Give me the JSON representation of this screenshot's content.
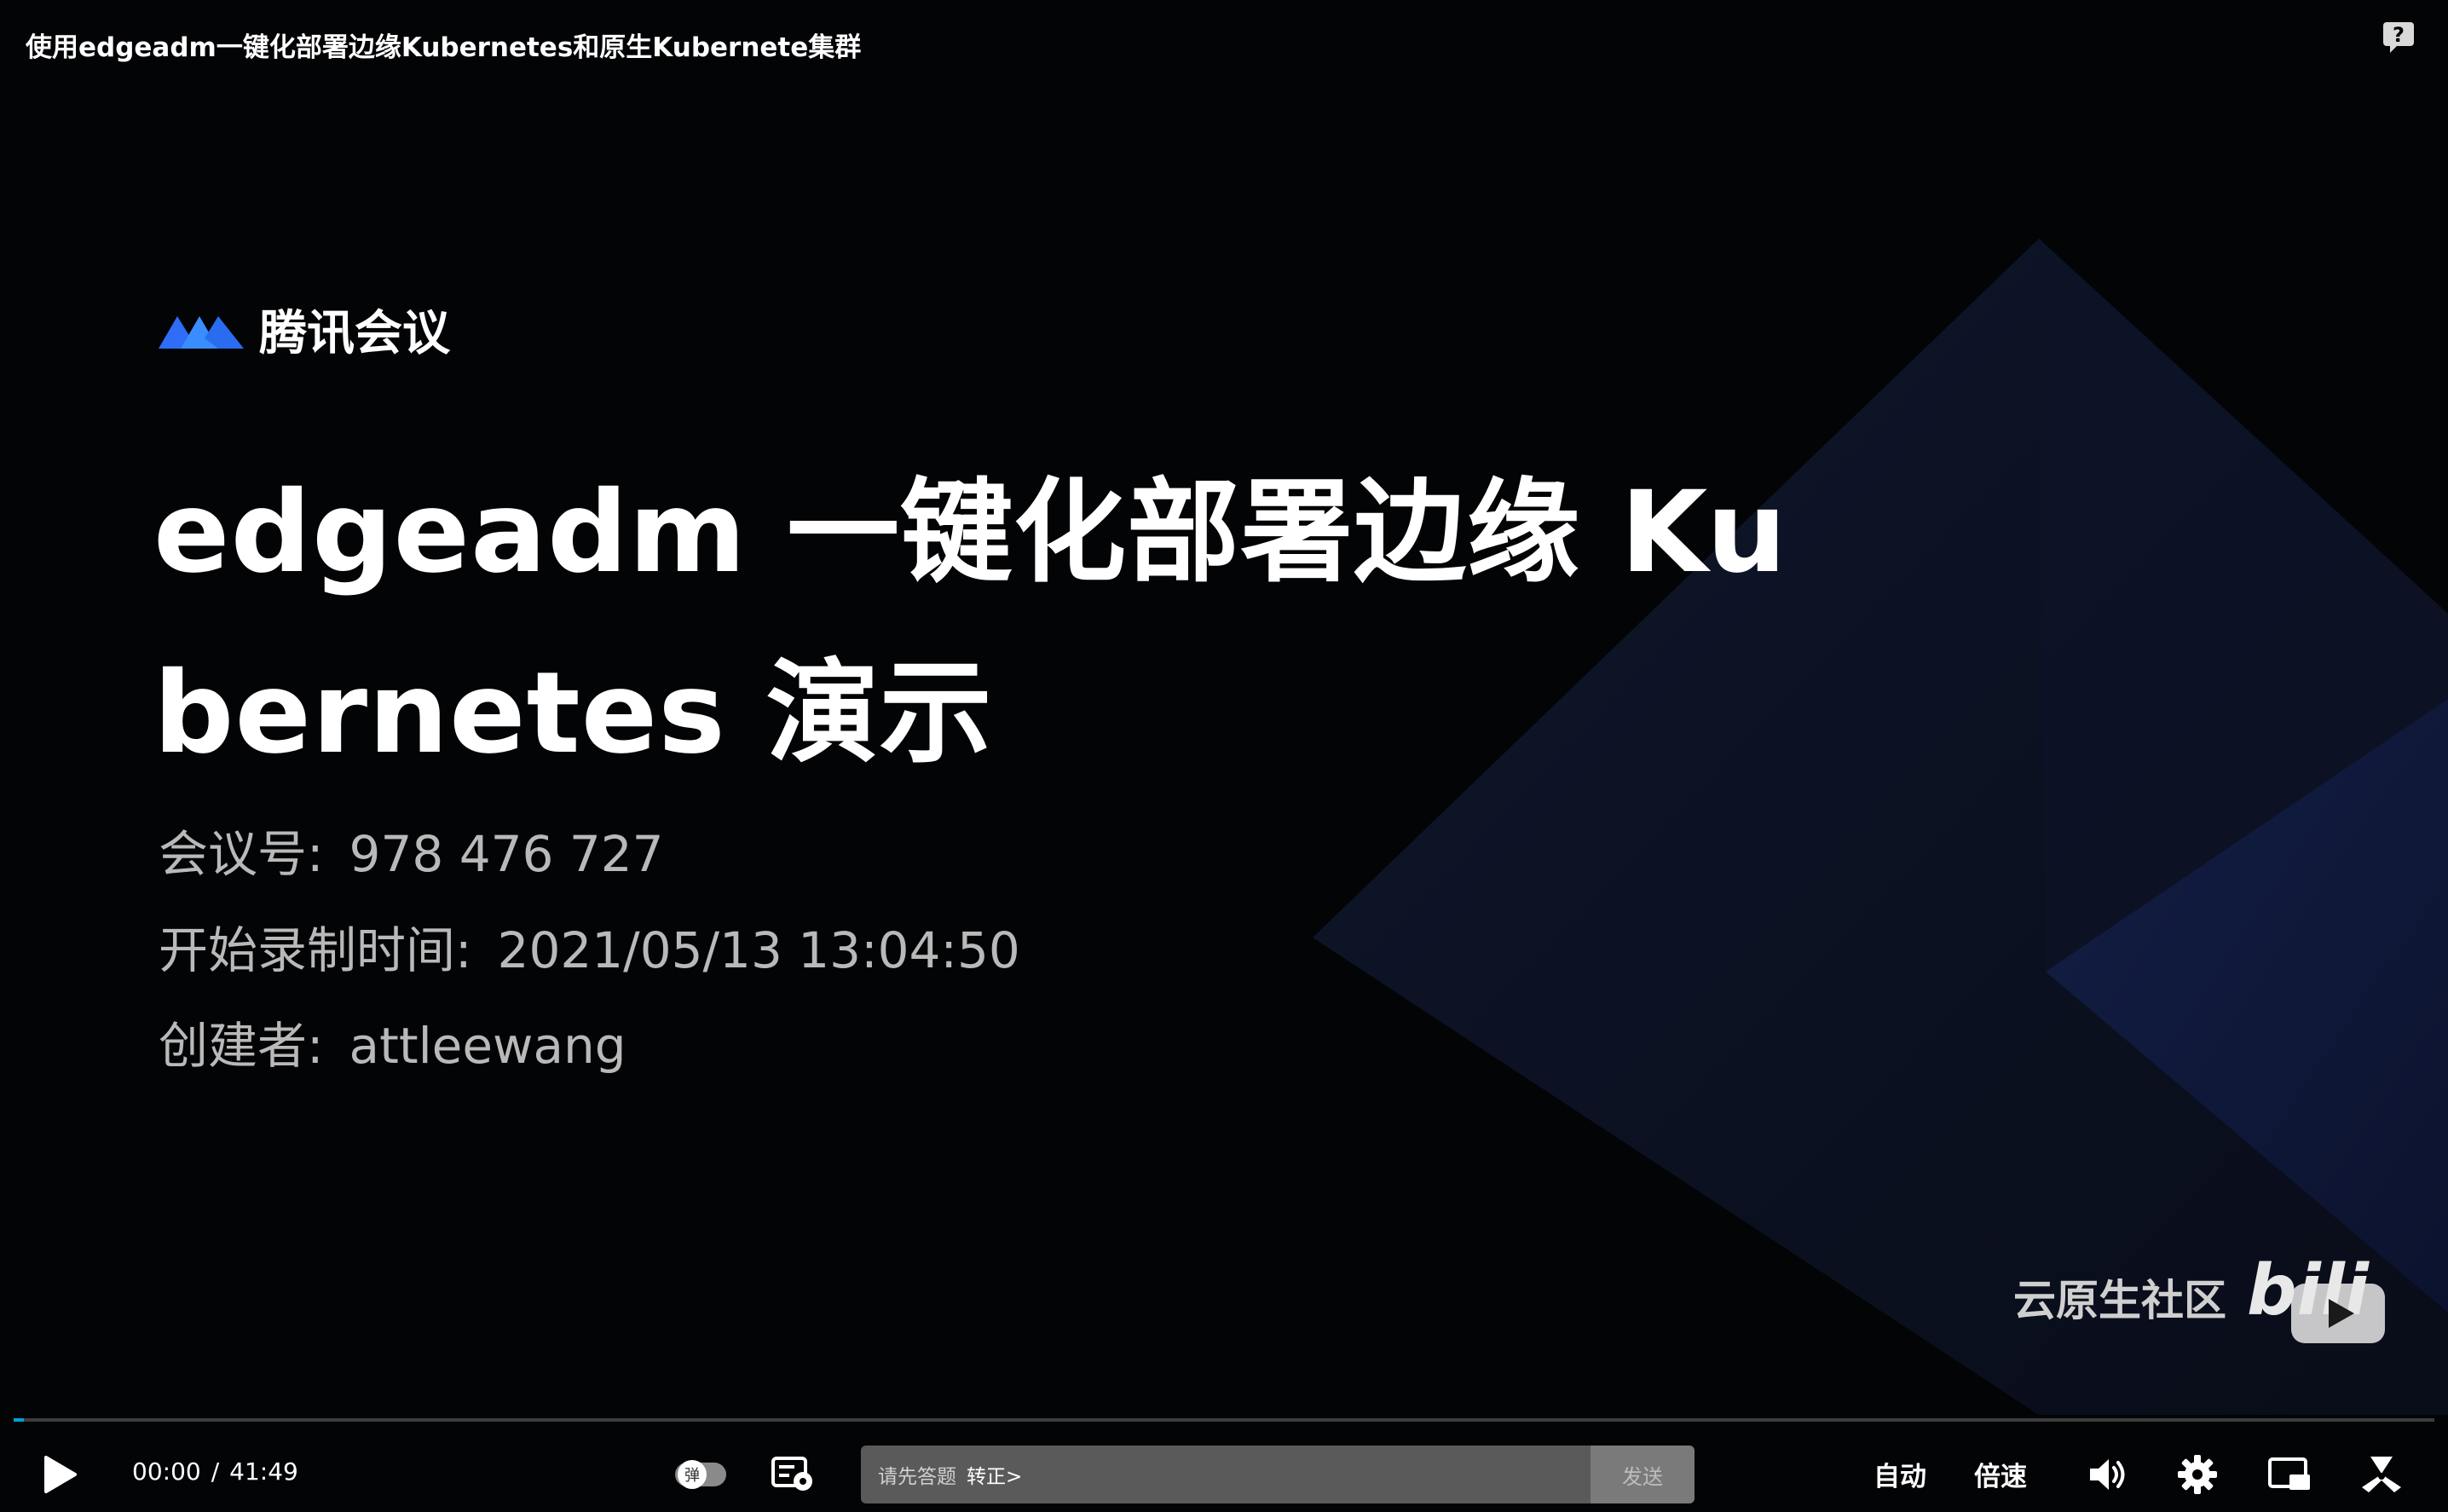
{
  "header": {
    "title": "使用edgeadm一键化部署边缘Kubernetes和原生Kubernete集群",
    "help_icon": "help-icon"
  },
  "slide": {
    "brand_name": "腾讯会议",
    "headline_line1": "edgeadm 一键化部署边缘 Ku",
    "headline_line2": "bernetes 演示",
    "meeting_id_label": "会议号:",
    "meeting_id_value": "978 476 727",
    "record_start_label": "开始录制时间:",
    "record_start_value": "2021/05/13 13:04:50",
    "creator_label": "创建者:",
    "creator_value": "attleewang",
    "watermark_text": "云原生社区",
    "watermark_logo": "bilibili-logo"
  },
  "player": {
    "current_time": "00:00",
    "time_separator": "/",
    "duration": "41:49",
    "progress_fraction": 0.004,
    "danmaku_toggle_label": "弹",
    "danmaku_hint": "请先答题",
    "danmaku_link": "转正>",
    "send_label": "发送",
    "quality_label": "自动",
    "speed_label": "倍速",
    "accent_color": "#00a1d6"
  }
}
